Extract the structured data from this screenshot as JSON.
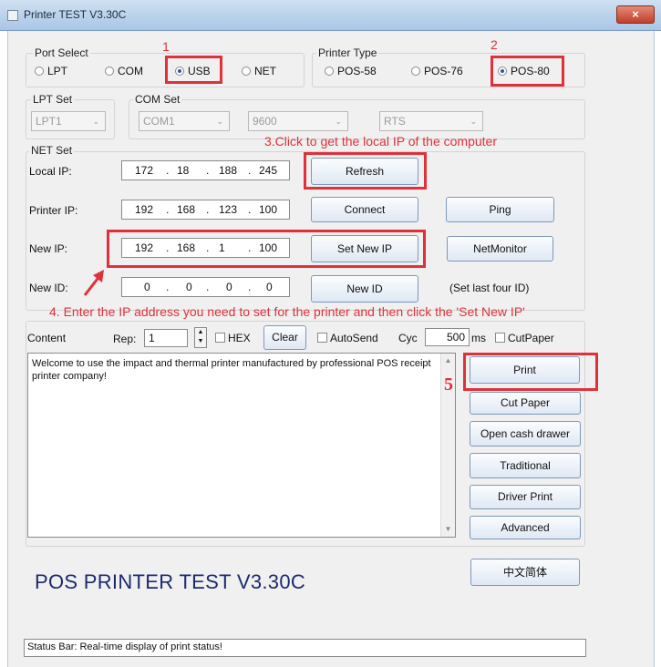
{
  "window": {
    "title": "Printer TEST V3.30C",
    "close_glyph": "×"
  },
  "port_select": {
    "label": "Port Select",
    "options": [
      "LPT",
      "COM",
      "USB",
      "NET"
    ],
    "selected": "USB"
  },
  "printer_type": {
    "label": "Printer Type",
    "options": [
      "POS-58",
      "POS-76",
      "POS-80"
    ],
    "selected": "POS-80"
  },
  "lpt_set": {
    "label": "LPT Set",
    "value": "LPT1"
  },
  "com_set": {
    "label": "COM Set",
    "port": "COM1",
    "baud": "9600",
    "flow": "RTS"
  },
  "net_set": {
    "label": "NET Set",
    "local_ip": {
      "label": "Local IP:",
      "octets": [
        "172",
        "18",
        "188",
        "245"
      ],
      "button": "Refresh"
    },
    "printer_ip": {
      "label": "Printer IP:",
      "octets": [
        "192",
        "168",
        "123",
        "100"
      ],
      "button": "Connect",
      "button2": "Ping"
    },
    "new_ip": {
      "label": "New IP:",
      "octets": [
        "192",
        "168",
        "1",
        "100"
      ],
      "button": "Set New IP",
      "button2": "NetMonitor"
    },
    "new_id": {
      "label": "New ID:",
      "octets": [
        "0",
        "0",
        "0",
        "0"
      ],
      "button": "New ID",
      "hint": "(Set last four ID)"
    }
  },
  "annotations": {
    "a1": "1",
    "a2": "2",
    "a3": "3.Click to get the local IP of the computer",
    "a4": "4. Enter the IP address you need to set for the printer and then click the 'Set New IP'",
    "a5": "5"
  },
  "content": {
    "label": "Content",
    "rep_label": "Rep:",
    "rep_value": "1",
    "hex_label": "HEX",
    "clear_button": "Clear",
    "autosend_label": "AutoSend",
    "cyc_label": "Cyc",
    "cyc_value": "500",
    "ms_label": "ms",
    "cutpaper_label": "CutPaper",
    "text": "Welcome to use the impact and thermal printer manufactured by professional POS receipt printer company!"
  },
  "actions": {
    "print": "Print",
    "cut_paper": "Cut Paper",
    "open_cash_drawer": "Open cash drawer",
    "traditional": "Traditional",
    "driver_print": "Driver Print",
    "advanced": "Advanced",
    "chinese": "中文简体"
  },
  "brand": {
    "text": "POS PRINTER TEST V3.30C"
  },
  "status_bar": {
    "text": "Status Bar: Real-time display of print status!"
  },
  "colors": {
    "annotation_red": "#e0303a",
    "brand_blue": "#1c2a6e"
  },
  "icons": {
    "title_icon": "printer-app-icon",
    "close_icon": "close-icon"
  }
}
